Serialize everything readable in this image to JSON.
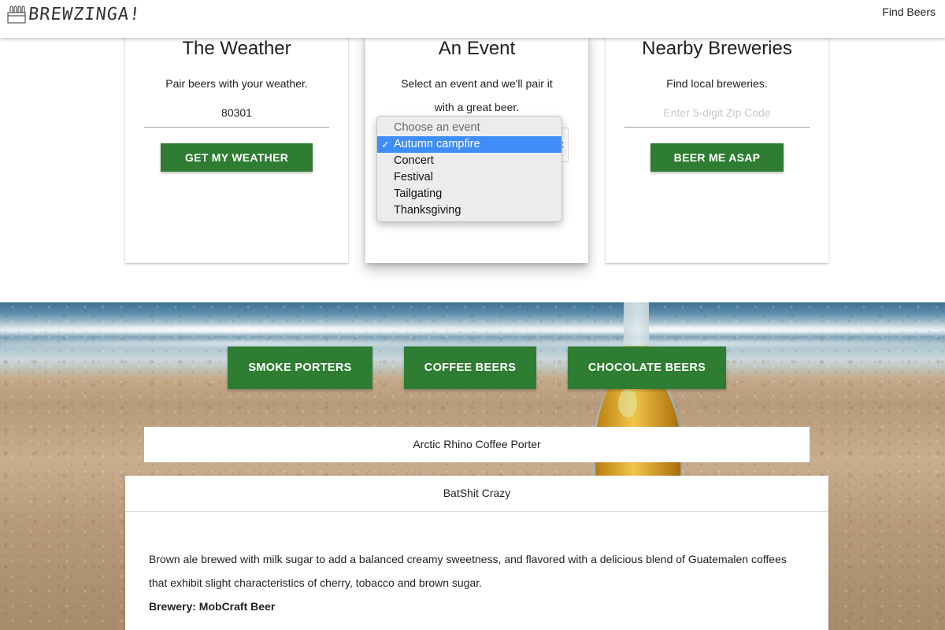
{
  "nav": {
    "logo_text": "BREWZINGA!",
    "find_beers": "Find Beers"
  },
  "weather_card": {
    "title": "The Weather",
    "description": "Pair beers with your weather.",
    "zip_value": "80301",
    "button": "GET MY WEATHER"
  },
  "event_card": {
    "title": "An Event",
    "description": "Select an event and we'll pair it with a great beer.",
    "select": {
      "options": [
        "Choose an event",
        "Autumn campfire",
        "Concert",
        "Festival",
        "Tailgating",
        "Thanksgiving"
      ],
      "selected": "Autumn campfire"
    }
  },
  "breweries_card": {
    "title": "Nearby Breweries",
    "description": "Find local breweries.",
    "zip_placeholder": "Enter 5-digit Zip Code",
    "button": "BEER ME ASAP"
  },
  "beer_styles": {
    "buttons": [
      "SMOKE PORTERS",
      "COFFEE BEERS",
      "CHOCOLATE BEERS"
    ]
  },
  "results": {
    "collapsed_item": "Arctic Rhino Coffee Porter",
    "expanded_item": {
      "name": "BatShit Crazy",
      "description": "Brown ale brewed with milk sugar to add a balanced creamy sweetness, and flavored with a delicious blend of Guatemalen coffees that exhibit slight characteristics of cherry, tobacco and brown sugar.",
      "brewery": "Brewery: MobCraft Beer"
    }
  },
  "colors": {
    "button_green": "#2e7d32",
    "select_highlight": "#3f8ef7"
  },
  "icons": {
    "logo": "beer-crate-icon",
    "checkmark": "checkmark-icon",
    "select_arrows": "select-arrows-icon"
  }
}
